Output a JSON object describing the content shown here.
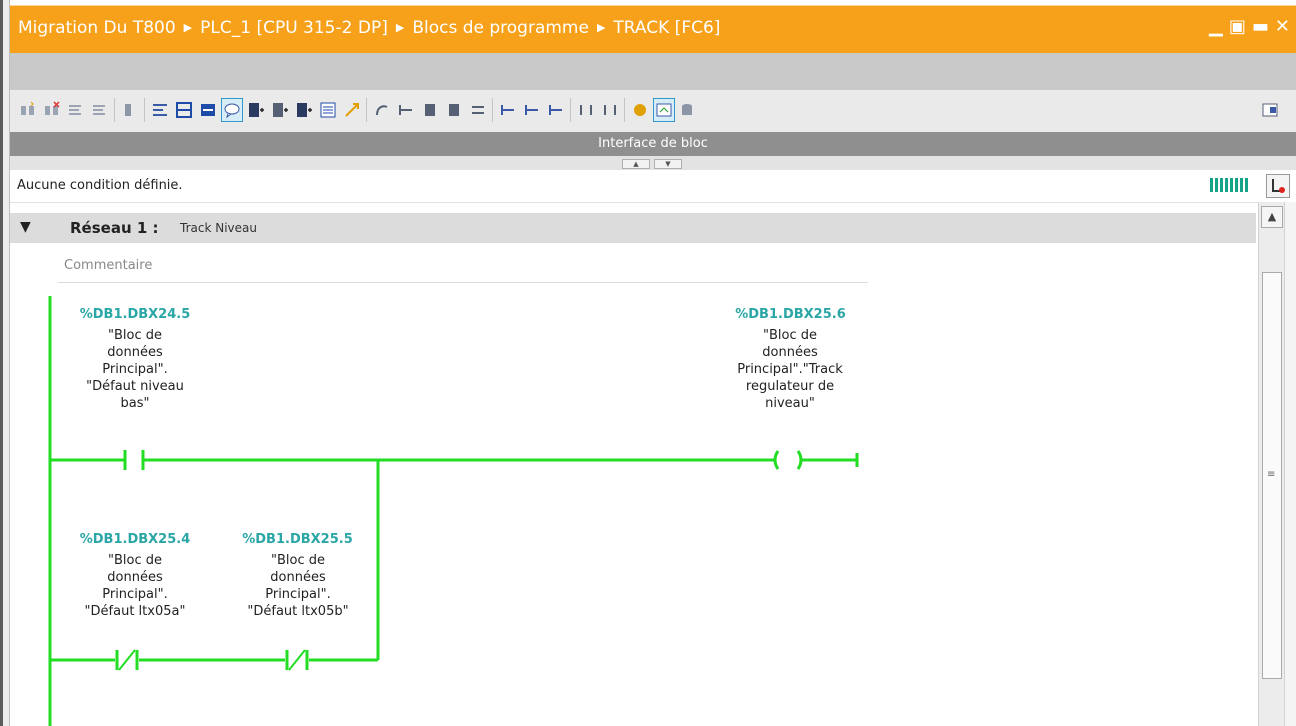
{
  "titlebar": {
    "crumbs": [
      "Migration Du T800",
      "PLC_1 [CPU 315-2 DP]",
      "Blocs de programme",
      "TRACK [FC6]"
    ],
    "window_controls": [
      "minimize-icon",
      "restore-icon",
      "maximize-icon",
      "close-icon"
    ]
  },
  "toolbar": {
    "icons": [
      "insert-network-icon",
      "delete-network-icon",
      "insert-row-icon",
      "append-row-icon",
      "reset-start-values-icon",
      "show-absolute-icon",
      "show-symbolic-icon",
      "symbol-info-icon",
      "comments-icon",
      "network-open-icon",
      "network-close-icon",
      "navigation-icon",
      "favorites-icon",
      "download-icon",
      "goto-icon",
      "rung-icon",
      "box-icon",
      "coil-icon",
      "monitor-icon",
      "branch-open-icon",
      "branch-close-icon",
      "compare-icon",
      "simulation-icon",
      "cross-reference-icon",
      "db-icon",
      "panel-icon"
    ],
    "interface_label": "Interface de bloc"
  },
  "condition_bar": {
    "text": "Aucune condition définie."
  },
  "network": {
    "title": "Réseau 1 :",
    "description": "Track Niveau",
    "comment_placeholder": "Commentaire",
    "contacts": [
      {
        "address": "%DB1.DBX24.5",
        "symbol": [
          "\"Bloc de",
          "données",
          "Principal\".",
          "\"Défaut niveau",
          "bas\""
        ],
        "type": "NO"
      },
      {
        "address": "%DB1.DBX25.4",
        "symbol": [
          "\"Bloc de",
          "données",
          "Principal\".",
          "\"Défaut ltx05a\""
        ],
        "type": "NC"
      },
      {
        "address": "%DB1.DBX25.5",
        "symbol": [
          "\"Bloc de",
          "données",
          "Principal\".",
          "\"Défaut ltx05b\""
        ],
        "type": "NC"
      }
    ],
    "coil": {
      "address": "%DB1.DBX25.6",
      "symbol": [
        "\"Bloc de",
        "données",
        "Principal\".\"Track",
        "regulateur de",
        "niveau\""
      ]
    }
  },
  "colors": {
    "accent": "#f7a11a",
    "rung": "#22dd22",
    "address": "#2aa6a6",
    "header_gray": "#8f8f8f"
  }
}
